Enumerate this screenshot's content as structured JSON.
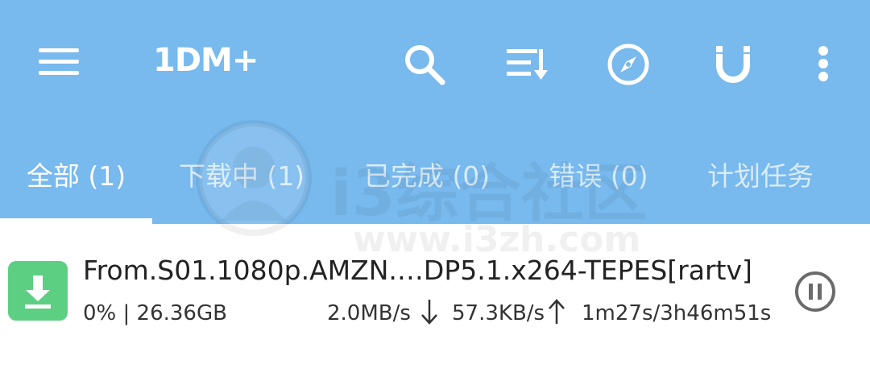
{
  "appbar": {
    "title": "1DM+",
    "color": "#78b9ee",
    "icons": [
      "menu-icon",
      "search-icon",
      "sort-icon",
      "browser-icon",
      "magnet-icon",
      "more-icon"
    ]
  },
  "tabs": [
    {
      "label": "全部 (1)",
      "active": true
    },
    {
      "label": "下载中 (1)",
      "active": false
    },
    {
      "label": "已完成 (0)",
      "active": false
    },
    {
      "label": "错误 (0)",
      "active": false
    },
    {
      "label": "计划任务",
      "active": false
    }
  ],
  "watermark": {
    "text": "i3综合社区",
    "url": "www.i3zh.com"
  },
  "download": {
    "file_name": "From.S01.1080p.AMZN.…DP5.1.x264-TEPES[rartv]",
    "progress_size": "0% | 26.36GB",
    "download_speed": "2.0MB/s",
    "upload_speed": "57.3KB/s",
    "time": "1m27s/3h46m51s",
    "icon_color": "#5ccf83"
  }
}
